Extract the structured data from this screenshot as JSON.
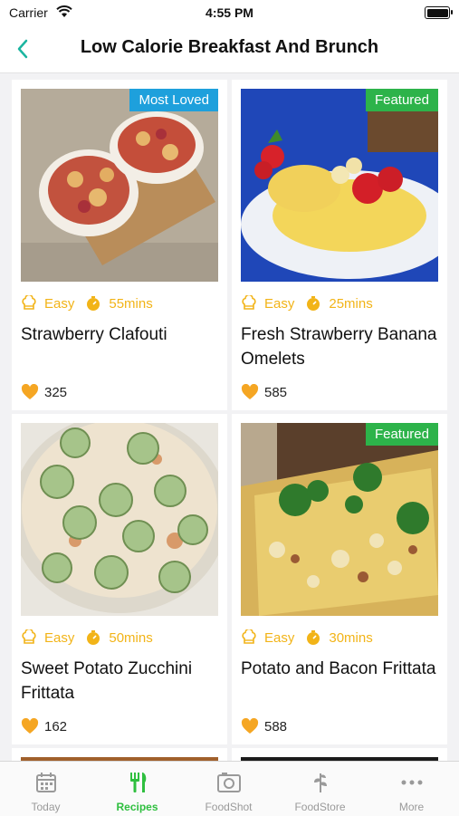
{
  "status": {
    "carrier": "Carrier",
    "time": "4:55 PM"
  },
  "header": {
    "title": "Low Calorie Breakfast And Brunch"
  },
  "colors": {
    "accent": "#2fbf3f",
    "meta": "#f2b418",
    "back": "#1bb5a0",
    "badge_blue": "#1ea0dc",
    "badge_green": "#2db34a"
  },
  "recipes": [
    {
      "title": "Strawberry Clafouti",
      "badge": "Most Loved",
      "difficulty": "Easy",
      "time": "55mins",
      "likes": "325"
    },
    {
      "title": "Fresh Strawberry Banana Omelets",
      "badge": "Featured",
      "difficulty": "Easy",
      "time": "25mins",
      "likes": "585"
    },
    {
      "title": "Sweet Potato Zucchini Frittata",
      "badge": "",
      "difficulty": "Easy",
      "time": "50mins",
      "likes": "162"
    },
    {
      "title": "Potato and Bacon Frittata",
      "badge": "Featured",
      "difficulty": "Easy",
      "time": "30mins",
      "likes": "588"
    }
  ],
  "tabs": [
    {
      "label": "Today",
      "icon": "calendar-icon",
      "active": false
    },
    {
      "label": "Recipes",
      "icon": "fork-knife-icon",
      "active": true
    },
    {
      "label": "FoodShot",
      "icon": "camera-icon",
      "active": false
    },
    {
      "label": "FoodStore",
      "icon": "leaf-icon",
      "active": false
    },
    {
      "label": "More",
      "icon": "more-dots-icon",
      "active": false
    }
  ]
}
